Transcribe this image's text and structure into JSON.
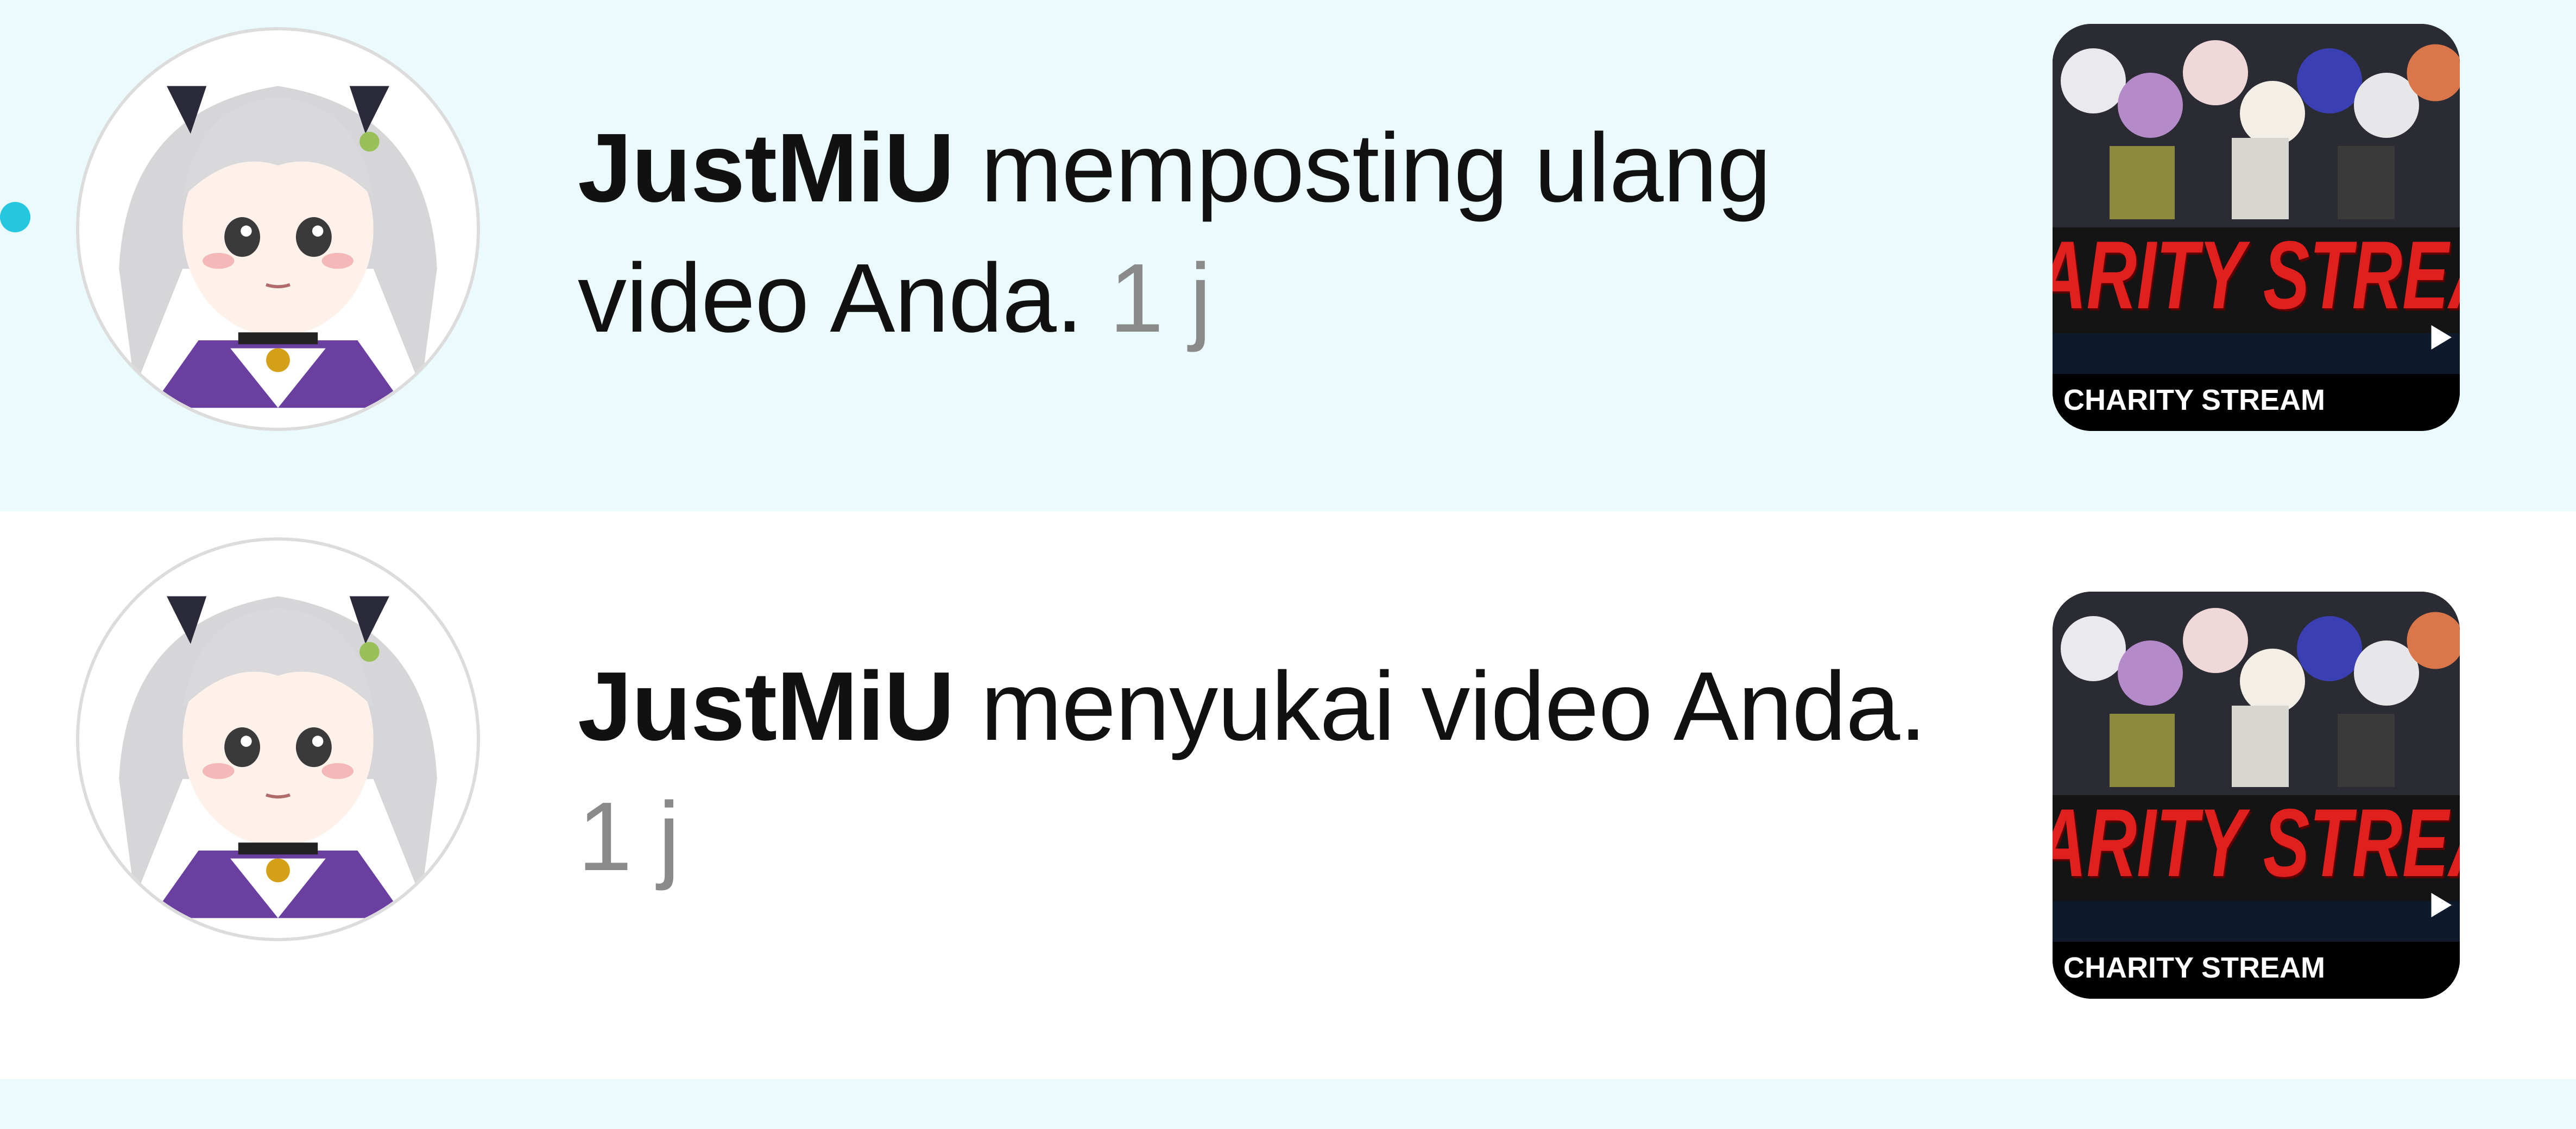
{
  "notifications": [
    {
      "state": "unread",
      "username": "JustMiU",
      "action": " memposting ulang video Anda. ",
      "time": "1 j",
      "thumbnail": {
        "banner": "ARITY STREA",
        "caption": "CHARITY STREAM"
      }
    },
    {
      "state": "read",
      "username": "JustMiU",
      "action": " menyukai video Anda. ",
      "time": "1 j",
      "thumbnail": {
        "banner": "ARITY STREA",
        "caption": "CHARITY STREAM"
      }
    }
  ],
  "colors": {
    "unread_bg": "#ebfafc",
    "unread_dot": "#25c7e0",
    "timestamp": "#8a8a8a",
    "banner_red": "#e0201f"
  }
}
